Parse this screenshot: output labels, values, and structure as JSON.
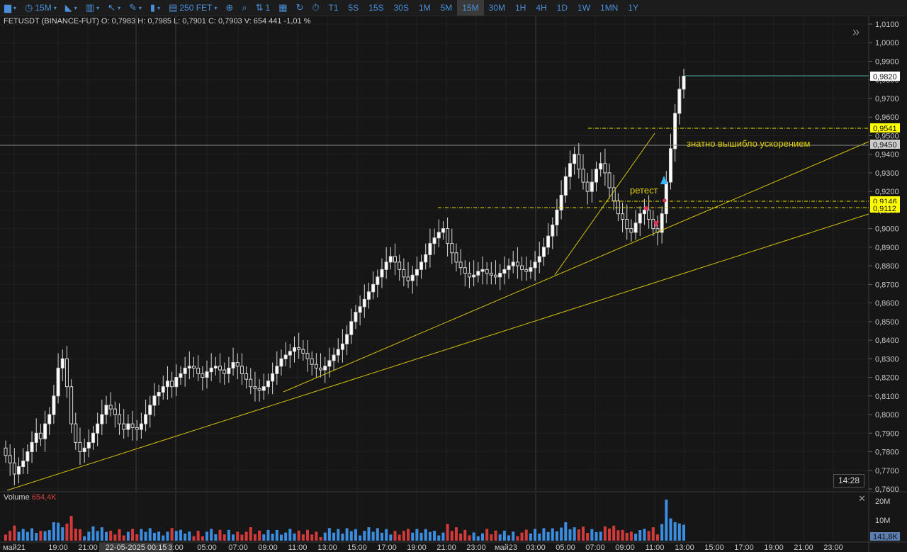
{
  "toolbar": {
    "items": [
      {
        "name": "folder",
        "icon": "folder-icon",
        "glyph": "▆",
        "label": ""
      },
      {
        "name": "interval",
        "icon": "clock-icon",
        "glyph": "◷",
        "label": "15M"
      },
      {
        "name": "chart-type",
        "icon": "area-chart-icon",
        "glyph": "◣",
        "label": ""
      },
      {
        "name": "layout",
        "icon": "layout-icon",
        "glyph": "▥",
        "label": ""
      },
      {
        "name": "cursor",
        "icon": "cursor-icon",
        "glyph": "↖",
        "label": ""
      },
      {
        "name": "draw",
        "icon": "pencil-icon",
        "glyph": "✎",
        "label": ""
      },
      {
        "name": "indicators",
        "icon": "bars-icon",
        "glyph": "▮",
        "label": ""
      },
      {
        "name": "instrument",
        "icon": "document-icon",
        "glyph": "▤",
        "label": "250 FET"
      }
    ],
    "tools": [
      {
        "name": "zoom",
        "icon": "zoom-icon",
        "glyph": "⊕"
      },
      {
        "name": "search",
        "icon": "search-icon",
        "glyph": "⌕"
      },
      {
        "name": "sort",
        "icon": "sort-icon",
        "glyph": "⇅",
        "label": "1"
      },
      {
        "name": "calendar",
        "icon": "calendar-icon",
        "glyph": "▦"
      },
      {
        "name": "refresh",
        "icon": "refresh-icon",
        "glyph": "↻"
      },
      {
        "name": "timer",
        "icon": "timer-icon",
        "glyph": "⏱"
      }
    ],
    "timeframes": [
      "T1",
      "5S",
      "15S",
      "30S",
      "1M",
      "5M",
      "15M",
      "30M",
      "1H",
      "4H",
      "1D",
      "1W",
      "1MN",
      "1Y"
    ],
    "active_timeframe": "15M"
  },
  "legend": {
    "symbol": "FETUSDT (BINANCE-FUT)",
    "ohlcv": "O: 0,7983  H: 0,7985  L: 0,7901  C: 0,7903  V: 654 441  -1,01 %"
  },
  "clock": "14:28",
  "volume": {
    "label": "Volume",
    "value": "654,4K"
  },
  "chart_data": {
    "type": "candlestick",
    "y_range": [
      0.76,
      1.01
    ],
    "y_ticks": [
      "1,0100",
      "1,0000",
      "0,9900",
      "0,9800",
      "0,9700",
      "0,9600",
      "0,9500",
      "0,9400",
      "0,9300",
      "0,9200",
      "0,9100",
      "0,9000",
      "0,8900",
      "0,8800",
      "0,8700",
      "0,8600",
      "0,8500",
      "0,8400",
      "0,8300",
      "0,8200",
      "0,8100",
      "0,8000",
      "0,7900",
      "0,7800",
      "0,7700",
      "0,7600"
    ],
    "x_ticks": [
      "май21",
      "19:00",
      "21:00",
      "22-05-2025 00:15",
      "3:00",
      "05:00",
      "07:00",
      "09:00",
      "11:00",
      "13:00",
      "15:00",
      "17:00",
      "19:00",
      "21:00",
      "23:00",
      "май23",
      "03:00",
      "05:00",
      "07:00",
      "09:00",
      "11:00",
      "13:00",
      "15:00",
      "17:00",
      "19:00",
      "21:00",
      "23:00"
    ],
    "volume_ticks": [
      "20M",
      "10M"
    ],
    "price_tags": [
      {
        "value": "0,9820",
        "price": 0.982,
        "color": "#ffffff"
      },
      {
        "value": "0,9541",
        "price": 0.9541,
        "color": "#ffff00"
      },
      {
        "value": "0,9450",
        "price": 0.945,
        "color": "#cccccc"
      },
      {
        "value": "0,9146",
        "price": 0.9146,
        "color": "#ffff00"
      },
      {
        "value": "0,9112",
        "price": 0.9112,
        "color": "#ffff00"
      }
    ],
    "volume_tag": "141,8K",
    "annotations": [
      {
        "text": "знатно вышибло  ускорением",
        "color": "#e0d000"
      },
      {
        "text": "ретест",
        "color": "#e0d000"
      }
    ],
    "closes": [
      0.778,
      0.774,
      0.768,
      0.772,
      0.775,
      0.78,
      0.785,
      0.79,
      0.787,
      0.795,
      0.8,
      0.81,
      0.825,
      0.83,
      0.815,
      0.795,
      0.785,
      0.78,
      0.782,
      0.785,
      0.79,
      0.795,
      0.8,
      0.805,
      0.803,
      0.8,
      0.795,
      0.792,
      0.795,
      0.793,
      0.792,
      0.795,
      0.8,
      0.805,
      0.81,
      0.812,
      0.815,
      0.818,
      0.815,
      0.82,
      0.822,
      0.825,
      0.826,
      0.825,
      0.822,
      0.82,
      0.823,
      0.825,
      0.826,
      0.824,
      0.822,
      0.825,
      0.828,
      0.826,
      0.822,
      0.819,
      0.815,
      0.814,
      0.813,
      0.815,
      0.818,
      0.822,
      0.826,
      0.83,
      0.832,
      0.834,
      0.836,
      0.835,
      0.833,
      0.83,
      0.827,
      0.825,
      0.824,
      0.826,
      0.829,
      0.832,
      0.835,
      0.838,
      0.843,
      0.85,
      0.855,
      0.858,
      0.862,
      0.866,
      0.87,
      0.874,
      0.878,
      0.882,
      0.885,
      0.882,
      0.878,
      0.874,
      0.872,
      0.875,
      0.878,
      0.882,
      0.886,
      0.892,
      0.895,
      0.898,
      0.9,
      0.892,
      0.887,
      0.882,
      0.879,
      0.876,
      0.874,
      0.875,
      0.877,
      0.878,
      0.876,
      0.875,
      0.874,
      0.876,
      0.878,
      0.88,
      0.882,
      0.88,
      0.878,
      0.877,
      0.879,
      0.882,
      0.885,
      0.89,
      0.896,
      0.902,
      0.91,
      0.918,
      0.928,
      0.935,
      0.94,
      0.932,
      0.925,
      0.92,
      0.925,
      0.932,
      0.935,
      0.93,
      0.922,
      0.915,
      0.908,
      0.905,
      0.9,
      0.898,
      0.903,
      0.908,
      0.91,
      0.905,
      0.9,
      0.898,
      0.908,
      0.925,
      0.943,
      0.962,
      0.975,
      0.982
    ]
  }
}
